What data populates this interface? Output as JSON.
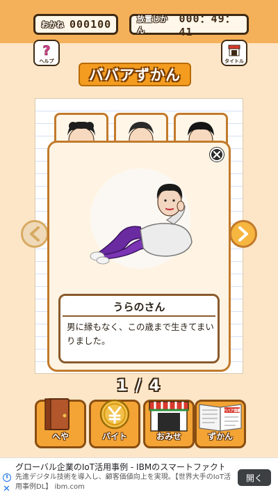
{
  "status": {
    "money_label": "おかね",
    "money_value": "000100",
    "time_label": "放置じかん",
    "time_value": "000：49：41"
  },
  "buttons": {
    "help_label": "ヘルプ",
    "title_label": "タイトル"
  },
  "banner": {
    "title": "ババアずかん"
  },
  "detail": {
    "name": "うらのさん",
    "description": "男に縁もなく、この歳まで生きてまいりました。"
  },
  "pager": {
    "text": "1 / 4"
  },
  "nav": [
    {
      "label": "へや",
      "icon": "door-icon"
    },
    {
      "label": "バイト",
      "icon": "yen-coin-icon"
    },
    {
      "label": "おみせ",
      "icon": "shop-icon"
    },
    {
      "label": "ずかん",
      "icon": "book-icon"
    }
  ],
  "nav_book_cover_text": "ババア図鑑",
  "ad": {
    "headline": "グローバル企業のIoT活用事例 - IBMのスマートファクトリー",
    "body": "先進デジタル技術を導入し、顧客価値向上を実現。【世界大手のIoT活用事例DL】 ibm.com",
    "cta": "開く"
  },
  "colors": {
    "top_bar": "#f5b15a",
    "background": "#fde6c7",
    "accent_orange": "#f39c1f",
    "frame_brown": "#c27a2c"
  }
}
